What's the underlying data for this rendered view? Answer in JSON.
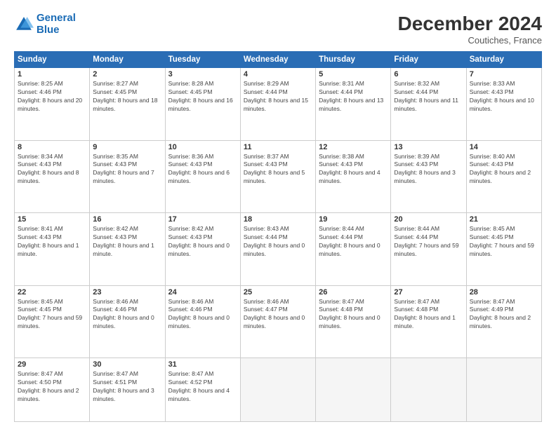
{
  "header": {
    "logo_line1": "General",
    "logo_line2": "Blue",
    "month": "December 2024",
    "location": "Coutiches, France"
  },
  "days_of_week": [
    "Sunday",
    "Monday",
    "Tuesday",
    "Wednesday",
    "Thursday",
    "Friday",
    "Saturday"
  ],
  "weeks": [
    [
      {
        "num": "1",
        "sunrise": "Sunrise: 8:25 AM",
        "sunset": "Sunset: 4:46 PM",
        "daylight": "Daylight: 8 hours and 20 minutes."
      },
      {
        "num": "2",
        "sunrise": "Sunrise: 8:27 AM",
        "sunset": "Sunset: 4:45 PM",
        "daylight": "Daylight: 8 hours and 18 minutes."
      },
      {
        "num": "3",
        "sunrise": "Sunrise: 8:28 AM",
        "sunset": "Sunset: 4:45 PM",
        "daylight": "Daylight: 8 hours and 16 minutes."
      },
      {
        "num": "4",
        "sunrise": "Sunrise: 8:29 AM",
        "sunset": "Sunset: 4:44 PM",
        "daylight": "Daylight: 8 hours and 15 minutes."
      },
      {
        "num": "5",
        "sunrise": "Sunrise: 8:31 AM",
        "sunset": "Sunset: 4:44 PM",
        "daylight": "Daylight: 8 hours and 13 minutes."
      },
      {
        "num": "6",
        "sunrise": "Sunrise: 8:32 AM",
        "sunset": "Sunset: 4:44 PM",
        "daylight": "Daylight: 8 hours and 11 minutes."
      },
      {
        "num": "7",
        "sunrise": "Sunrise: 8:33 AM",
        "sunset": "Sunset: 4:43 PM",
        "daylight": "Daylight: 8 hours and 10 minutes."
      }
    ],
    [
      {
        "num": "8",
        "sunrise": "Sunrise: 8:34 AM",
        "sunset": "Sunset: 4:43 PM",
        "daylight": "Daylight: 8 hours and 8 minutes."
      },
      {
        "num": "9",
        "sunrise": "Sunrise: 8:35 AM",
        "sunset": "Sunset: 4:43 PM",
        "daylight": "Daylight: 8 hours and 7 minutes."
      },
      {
        "num": "10",
        "sunrise": "Sunrise: 8:36 AM",
        "sunset": "Sunset: 4:43 PM",
        "daylight": "Daylight: 8 hours and 6 minutes."
      },
      {
        "num": "11",
        "sunrise": "Sunrise: 8:37 AM",
        "sunset": "Sunset: 4:43 PM",
        "daylight": "Daylight: 8 hours and 5 minutes."
      },
      {
        "num": "12",
        "sunrise": "Sunrise: 8:38 AM",
        "sunset": "Sunset: 4:43 PM",
        "daylight": "Daylight: 8 hours and 4 minutes."
      },
      {
        "num": "13",
        "sunrise": "Sunrise: 8:39 AM",
        "sunset": "Sunset: 4:43 PM",
        "daylight": "Daylight: 8 hours and 3 minutes."
      },
      {
        "num": "14",
        "sunrise": "Sunrise: 8:40 AM",
        "sunset": "Sunset: 4:43 PM",
        "daylight": "Daylight: 8 hours and 2 minutes."
      }
    ],
    [
      {
        "num": "15",
        "sunrise": "Sunrise: 8:41 AM",
        "sunset": "Sunset: 4:43 PM",
        "daylight": "Daylight: 8 hours and 1 minute."
      },
      {
        "num": "16",
        "sunrise": "Sunrise: 8:42 AM",
        "sunset": "Sunset: 4:43 PM",
        "daylight": "Daylight: 8 hours and 1 minute."
      },
      {
        "num": "17",
        "sunrise": "Sunrise: 8:42 AM",
        "sunset": "Sunset: 4:43 PM",
        "daylight": "Daylight: 8 hours and 0 minutes."
      },
      {
        "num": "18",
        "sunrise": "Sunrise: 8:43 AM",
        "sunset": "Sunset: 4:44 PM",
        "daylight": "Daylight: 8 hours and 0 minutes."
      },
      {
        "num": "19",
        "sunrise": "Sunrise: 8:44 AM",
        "sunset": "Sunset: 4:44 PM",
        "daylight": "Daylight: 8 hours and 0 minutes."
      },
      {
        "num": "20",
        "sunrise": "Sunrise: 8:44 AM",
        "sunset": "Sunset: 4:44 PM",
        "daylight": "Daylight: 7 hours and 59 minutes."
      },
      {
        "num": "21",
        "sunrise": "Sunrise: 8:45 AM",
        "sunset": "Sunset: 4:45 PM",
        "daylight": "Daylight: 7 hours and 59 minutes."
      }
    ],
    [
      {
        "num": "22",
        "sunrise": "Sunrise: 8:45 AM",
        "sunset": "Sunset: 4:45 PM",
        "daylight": "Daylight: 7 hours and 59 minutes."
      },
      {
        "num": "23",
        "sunrise": "Sunrise: 8:46 AM",
        "sunset": "Sunset: 4:46 PM",
        "daylight": "Daylight: 8 hours and 0 minutes."
      },
      {
        "num": "24",
        "sunrise": "Sunrise: 8:46 AM",
        "sunset": "Sunset: 4:46 PM",
        "daylight": "Daylight: 8 hours and 0 minutes."
      },
      {
        "num": "25",
        "sunrise": "Sunrise: 8:46 AM",
        "sunset": "Sunset: 4:47 PM",
        "daylight": "Daylight: 8 hours and 0 minutes."
      },
      {
        "num": "26",
        "sunrise": "Sunrise: 8:47 AM",
        "sunset": "Sunset: 4:48 PM",
        "daylight": "Daylight: 8 hours and 0 minutes."
      },
      {
        "num": "27",
        "sunrise": "Sunrise: 8:47 AM",
        "sunset": "Sunset: 4:48 PM",
        "daylight": "Daylight: 8 hours and 1 minute."
      },
      {
        "num": "28",
        "sunrise": "Sunrise: 8:47 AM",
        "sunset": "Sunset: 4:49 PM",
        "daylight": "Daylight: 8 hours and 2 minutes."
      }
    ],
    [
      {
        "num": "29",
        "sunrise": "Sunrise: 8:47 AM",
        "sunset": "Sunset: 4:50 PM",
        "daylight": "Daylight: 8 hours and 2 minutes."
      },
      {
        "num": "30",
        "sunrise": "Sunrise: 8:47 AM",
        "sunset": "Sunset: 4:51 PM",
        "daylight": "Daylight: 8 hours and 3 minutes."
      },
      {
        "num": "31",
        "sunrise": "Sunrise: 8:47 AM",
        "sunset": "Sunset: 4:52 PM",
        "daylight": "Daylight: 8 hours and 4 minutes."
      },
      null,
      null,
      null,
      null
    ]
  ]
}
